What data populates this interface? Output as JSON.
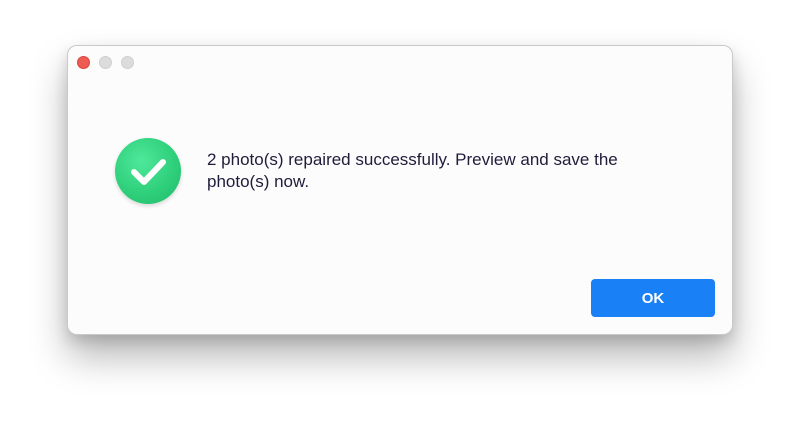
{
  "window": {
    "controls": [
      "close",
      "minimize",
      "maximize"
    ]
  },
  "dialog": {
    "icon": "success-check-icon",
    "message": "2 photo(s) repaired successfully. Preview and save the photo(s) now.",
    "ok_label": "OK"
  },
  "colors": {
    "accent": "#1a80f5",
    "success": "#2fd07c",
    "close_light": "#ee5b53"
  }
}
